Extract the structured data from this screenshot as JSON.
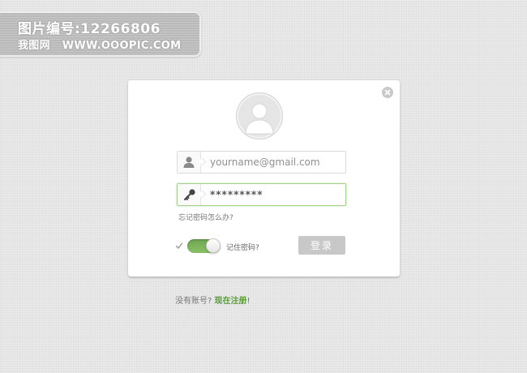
{
  "watermark": {
    "line1": "图片编号:12266806",
    "line2_site": "我图网",
    "line2_url": "WWW.OOOPIC.COM"
  },
  "login": {
    "username_placeholder": "yourname@gmail.com",
    "password_value": "*********",
    "forgot_password": "忘记密码怎么办?",
    "remember_label": "记住密码?",
    "remember_enabled": true,
    "login_button": "登录"
  },
  "register": {
    "prompt": "没有账号?",
    "link": "现在注册",
    "suffix": "!"
  },
  "colors": {
    "accent_green": "#7cb45a",
    "link_green": "#5b9a3c",
    "button_disabled": "#c8c8c8",
    "background": "#e6e6e6"
  },
  "icons": {
    "close": "close-icon",
    "avatar": "user-avatar-icon",
    "username": "user-icon",
    "password": "key-icon",
    "check": "check-icon"
  }
}
